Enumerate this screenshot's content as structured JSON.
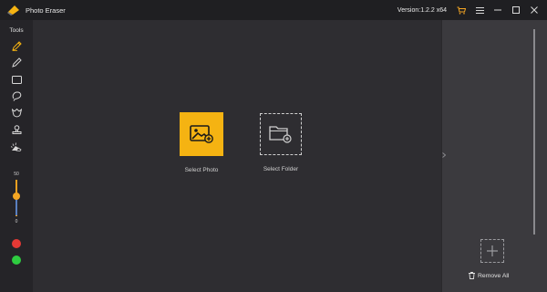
{
  "titlebar": {
    "app_title": "Photo Eraser",
    "version": "Version:1.2.2 x64",
    "icons": [
      "app-logo-icon",
      "cart-icon",
      "menu-icon",
      "minimize-icon",
      "maximize-icon",
      "close-icon"
    ]
  },
  "toolbar": {
    "tools_label": "Tools",
    "tools": [
      "smart-brush-icon",
      "pencil-icon",
      "rectangle-icon",
      "lasso-icon",
      "polygon-lasso-icon",
      "stamp-icon",
      "eraser-icon"
    ],
    "brush_size_max": "50",
    "brush_size_min": "0",
    "brush_level": 0.55,
    "colors": {
      "red": "#e53935",
      "green": "#2ecc40"
    }
  },
  "main": {
    "select_photo_label": "Select Photo",
    "select_folder_label": "Select Folder"
  },
  "right_panel": {
    "remove_all_label": "Remove All"
  },
  "theme": {
    "accent": "#f5b312",
    "background": "#2e2d31",
    "panel": "#3b3a3e"
  }
}
